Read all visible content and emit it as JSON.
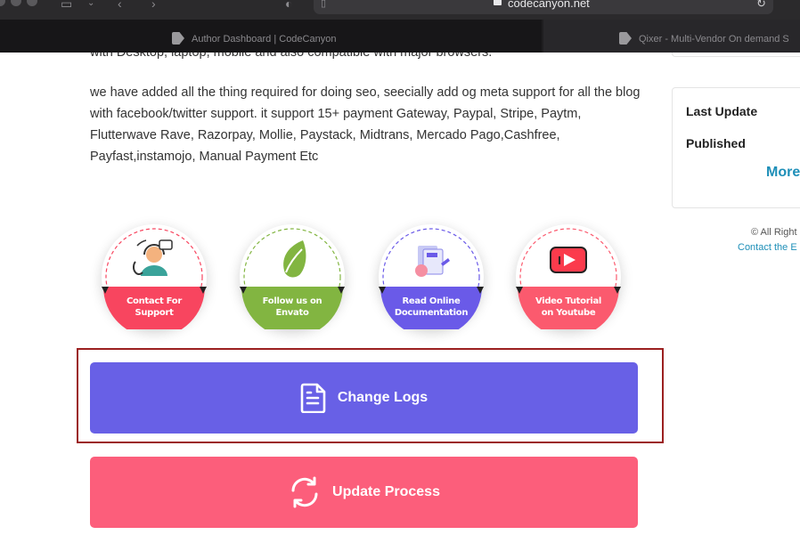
{
  "browser": {
    "url": "codecanyon.net",
    "tabs": [
      {
        "label": "Author Dashboard | CodeCanyon",
        "active": true
      },
      {
        "label": "Qixer - Multi-Vendor On demand S",
        "active": false
      }
    ]
  },
  "content": {
    "para_top": "with Desktop, laptop, mobile and also compatible with major browsers.",
    "para_main": "we have added all the thing required for doing seo, seecially add og meta support for all the blog with facebook/twitter support. it support 15+ payment Gateway, Paypal, Stripe, Paytm, Flutterwave Rave, Razorpay, Mollie, Paystack, Midtrans, Mercado Pago,Cashfree, Payfast,instamojo, Manual Payment Etc",
    "badges": [
      {
        "line1": "Contact For",
        "line2": "Support",
        "color": "#f8455f",
        "icon": "support-agent-icon"
      },
      {
        "line1": "Follow us on",
        "line2": "Envato",
        "color": "#82b541",
        "icon": "envato-leaf-icon"
      },
      {
        "line1": "Read Online",
        "line2": "Documentation",
        "color": "#6a5ae8",
        "icon": "documentation-icon"
      },
      {
        "line1": "Video Tutorial",
        "line2": "on Youtube",
        "color": "#fb5a6e",
        "icon": "youtube-icon"
      }
    ],
    "buttons": {
      "change_logs": "Change Logs",
      "update_process": "Update Process"
    }
  },
  "sidebar": {
    "last_update_label": "Last Update",
    "published_label": "Published",
    "more_label": "More",
    "copyright": "© All Right",
    "contact": "Contact the E"
  },
  "colors": {
    "change_logs_bg": "#6860e6",
    "update_process_bg": "#fc5e7b",
    "link": "#1e8fb8",
    "highlight_border": "#9b2020"
  }
}
